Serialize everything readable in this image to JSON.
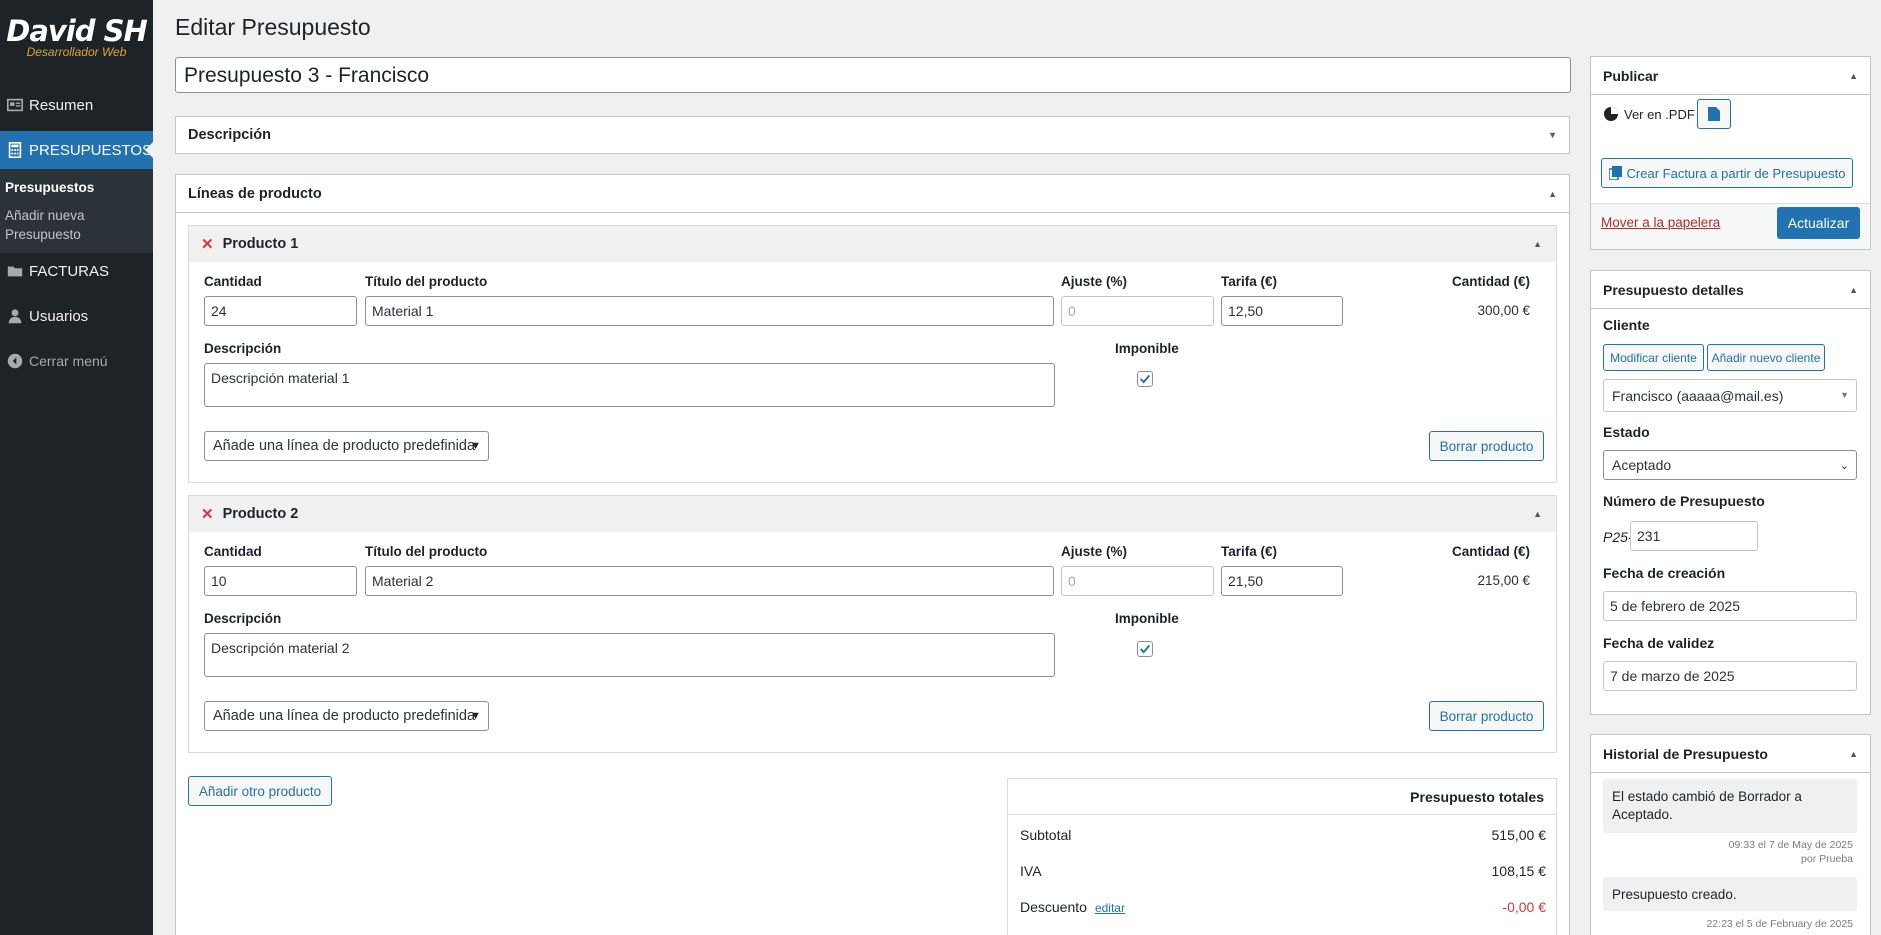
{
  "brand": {
    "name": "David SH",
    "tagline": "Desarrollador Web",
    "accent": "#d9a73a"
  },
  "sidebar": {
    "items": [
      {
        "label": "Resumen",
        "icon": "dashboard-icon"
      },
      {
        "label": "PRESUPUESTOS",
        "icon": "calculator-icon"
      },
      {
        "label": "FACTURAS",
        "icon": "folder-icon"
      },
      {
        "label": "Usuarios",
        "icon": "user-icon"
      },
      {
        "label": "Cerrar menú",
        "icon": "collapse-icon"
      }
    ],
    "submenu": {
      "current": "Presupuestos",
      "add_new": "Añadir nueva Presupuesto"
    }
  },
  "page": {
    "title": "Editar Presupuesto",
    "post_title": "Presupuesto 3 - Francisco"
  },
  "description_box": {
    "title": "Descripción"
  },
  "lines_box": {
    "title": "Líneas de producto"
  },
  "labels": {
    "quantity": "Cantidad",
    "product_title": "Título del producto",
    "adjust": "Ajuste (%)",
    "rate": "Tarifa (€)",
    "amount": "Cantidad (€)",
    "description": "Descripción",
    "taxable": "Imponible",
    "predefined": "Añade una línea de producto predefinida",
    "delete": "Borrar producto"
  },
  "products": [
    {
      "header": "Producto 1",
      "qty": "24",
      "title": "Material 1",
      "adjust_placeholder": "0",
      "rate": "12,50",
      "amount": "300,00 €",
      "description": "Descripción material 1",
      "taxable": true
    },
    {
      "header": "Producto 2",
      "qty": "10",
      "title": "Material 2",
      "adjust_placeholder": "0",
      "rate": "21,50",
      "amount": "215,00 €",
      "description": "Descripción material 2",
      "taxable": true
    }
  ],
  "add_product": "Añadir otro producto",
  "totals": {
    "title": "Presupuesto totales",
    "subtotal_label": "Subtotal",
    "subtotal": "515,00 €",
    "iva_label": "IVA",
    "iva": "108,15 €",
    "discount_label": "Descuento",
    "discount_edit": "editar",
    "discount": "-0,00 €"
  },
  "publish": {
    "title": "Publicar",
    "view_pdf": "Ver en .PDF",
    "create_invoice": "Crear Factura a partir de Presupuesto",
    "trash": "Mover a la papelera",
    "update": "Actualizar"
  },
  "details": {
    "title": "Presupuesto detalles",
    "client_label": "Cliente",
    "modify_client": "Modificar cliente",
    "add_client": "Añadir nuevo cliente",
    "client_value": "Francisco (aaaaa@mail.es)",
    "status_label": "Estado",
    "status_value": "Aceptado",
    "number_label": "Número de Presupuesto",
    "number_prefix": "P25-",
    "number_value": "231",
    "created_label": "Fecha de creación",
    "created_value": "5 de febrero de 2025",
    "valid_label": "Fecha de validez",
    "valid_value": "7 de marzo de 2025"
  },
  "history": {
    "title": "Historial de Presupuesto",
    "notes": [
      {
        "text": "El estado cambió de Borrador a Aceptado.",
        "time": "09:33 el 7 de May de 2025",
        "by": "por Prueba"
      },
      {
        "text": "Presupuesto creado.",
        "time": "22:23 el 5 de February de 2025"
      }
    ]
  },
  "colors": {
    "primary": "#2271b1",
    "danger": "#d63638",
    "sidebar": "#1d2327"
  }
}
